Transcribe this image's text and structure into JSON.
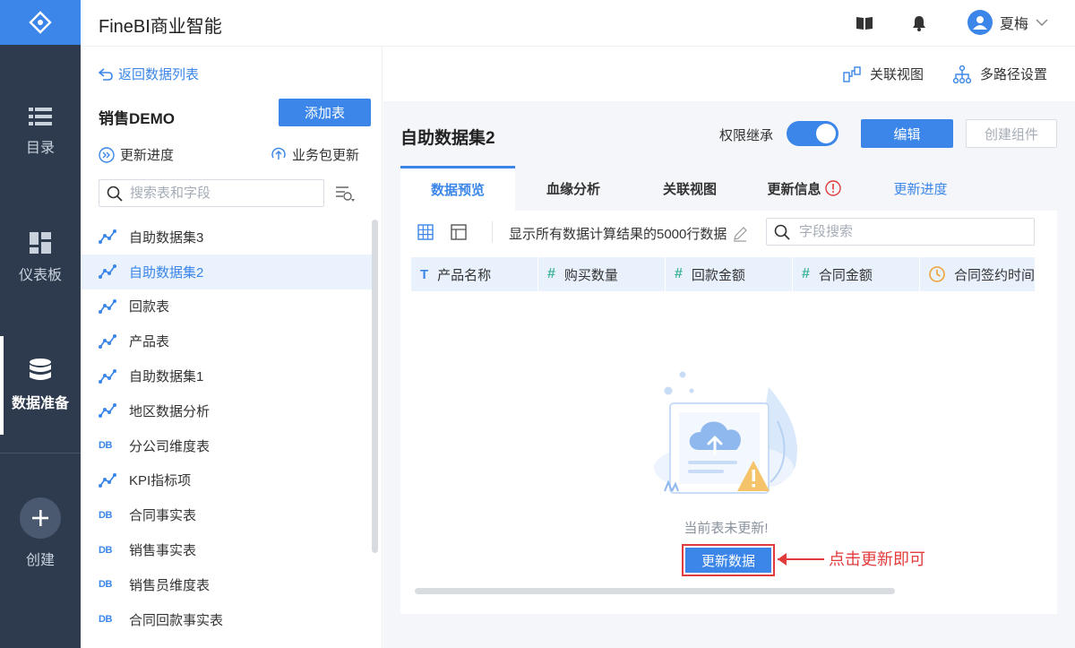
{
  "app": {
    "title": "FineBI商业智能"
  },
  "nav": {
    "items": [
      {
        "label": "目录",
        "icon": "list-icon"
      },
      {
        "label": "仪表板",
        "icon": "dashboard-icon"
      },
      {
        "label": "数据准备",
        "icon": "database-icon",
        "active": true
      },
      {
        "label": "创建",
        "icon": "plus-icon"
      }
    ]
  },
  "header": {
    "user_name": "夏梅"
  },
  "left_panel": {
    "back_label": "返回数据列表",
    "package_title": "销售DEMO",
    "add_table_label": "添加表",
    "update_progress_label": "更新进度",
    "package_update_label": "业务包更新",
    "search_placeholder": "搜索表和字段",
    "tables": [
      {
        "name": "自助数据集3",
        "type": "self"
      },
      {
        "name": "自助数据集2",
        "type": "self",
        "selected": true
      },
      {
        "name": "回款表",
        "type": "self"
      },
      {
        "name": "产品表",
        "type": "self"
      },
      {
        "name": "自助数据集1",
        "type": "self"
      },
      {
        "name": "地区数据分析",
        "type": "self"
      },
      {
        "name": "分公司维度表",
        "type": "db",
        "badge": "DB"
      },
      {
        "name": "KPI指标项",
        "type": "self"
      },
      {
        "name": "合同事实表",
        "type": "db",
        "badge": "DB"
      },
      {
        "name": "销售事实表",
        "type": "db",
        "badge": "DB"
      },
      {
        "name": "销售员维度表",
        "type": "db",
        "badge": "DB"
      },
      {
        "name": "合同回款事实表",
        "type": "db",
        "badge": "DB"
      }
    ]
  },
  "right_top": {
    "relation_view_label": "关联视图",
    "multipath_label": "多路径设置"
  },
  "dataset": {
    "title": "自助数据集2",
    "permission_label": "权限继承",
    "permission_on": true,
    "edit_label": "编辑",
    "create_component_label": "创建组件"
  },
  "tabs": [
    {
      "label": "数据预览",
      "active": true
    },
    {
      "label": "血缘分析"
    },
    {
      "label": "关联视图"
    },
    {
      "label": "更新信息"
    },
    {
      "label": "更新进度",
      "link": true
    }
  ],
  "toolbar": {
    "description": "显示所有数据计算结果的5000行数据",
    "field_search_placeholder": "字段搜索"
  },
  "columns": [
    {
      "type_symbol": "T",
      "name": "产品名称"
    },
    {
      "type_symbol": "#",
      "name": "购买数量"
    },
    {
      "type_symbol": "#",
      "name": "回款金额"
    },
    {
      "type_symbol": "#",
      "name": "合同金额"
    },
    {
      "type_symbol": "clock",
      "name": "合同签约时间"
    }
  ],
  "empty_state": {
    "message": "当前表未更新!",
    "update_button_label": "更新数据",
    "annotation": "点击更新即可"
  },
  "colors": {
    "accent": "#3b86e8",
    "nav_bg": "#2e3b4e",
    "annotation": "#e23b3b"
  }
}
